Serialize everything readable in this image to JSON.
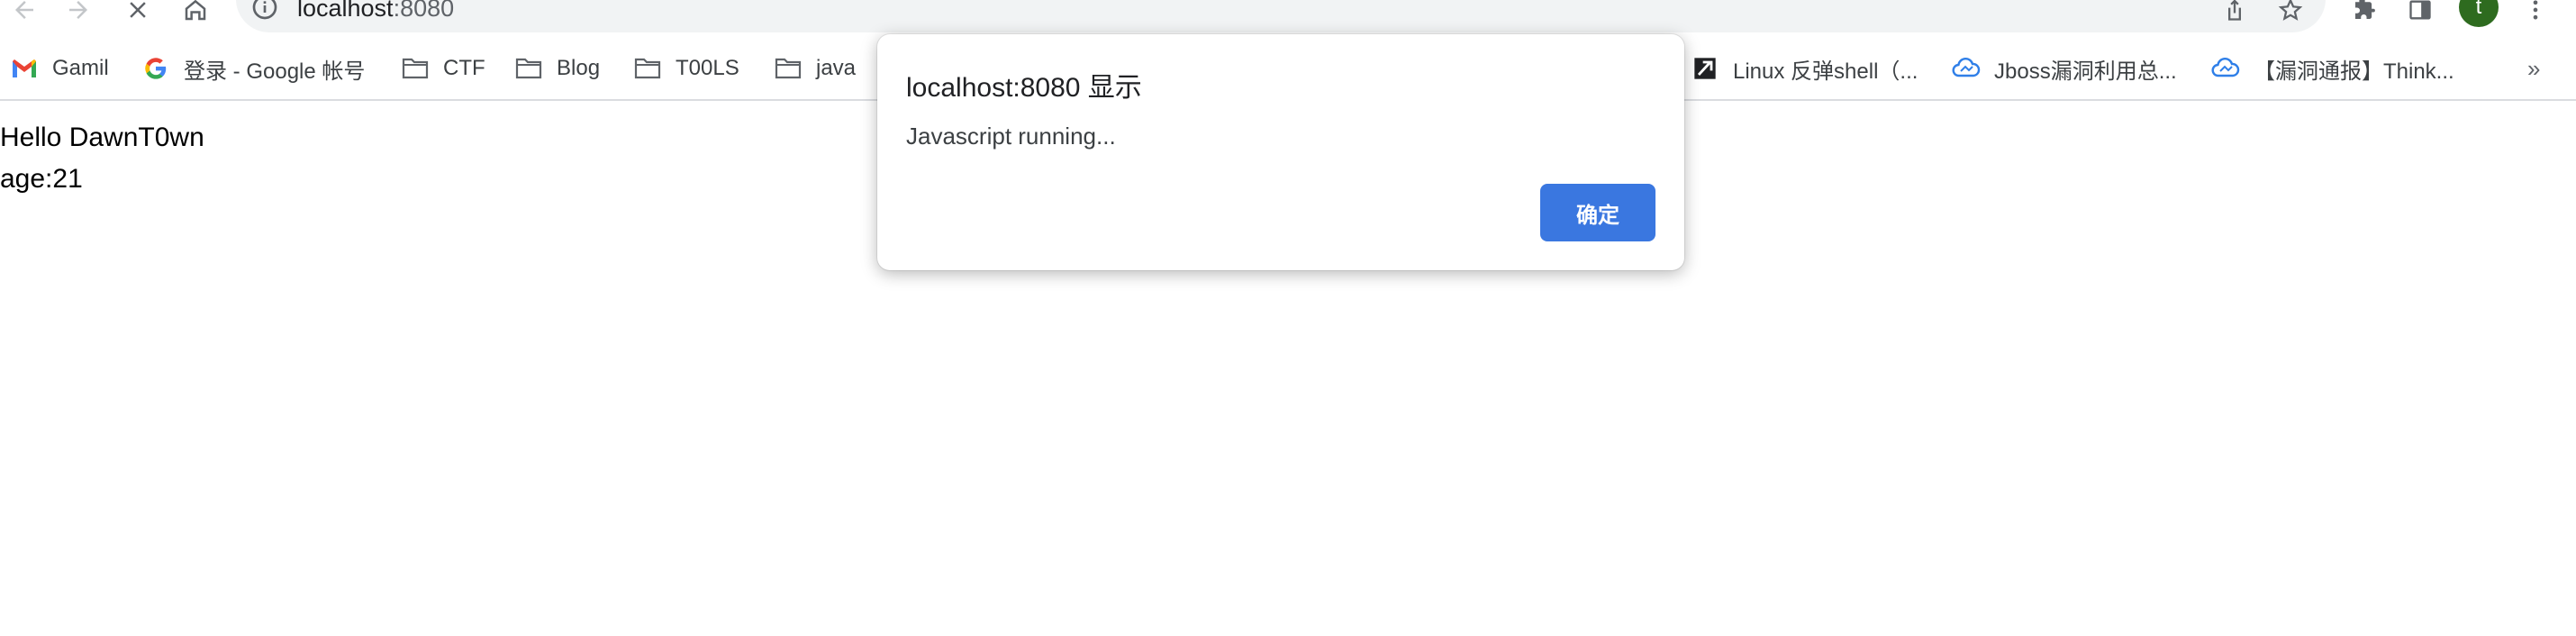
{
  "toolbar": {
    "url_host": "localhost",
    "url_port": ":8080",
    "avatar_initial": "t",
    "colors": {
      "avatar_bg": "#2e6b1f",
      "omnibox_bg": "#f1f3f4"
    }
  },
  "bookmarks": [
    {
      "label": "Gamil",
      "icon": "gmail-icon"
    },
    {
      "label": "登录 - Google 帐号",
      "icon": "google-icon"
    },
    {
      "label": "CTF",
      "icon": "folder-icon"
    },
    {
      "label": "Blog",
      "icon": "folder-icon"
    },
    {
      "label": "T00LS",
      "icon": "folder-icon"
    },
    {
      "label": "java",
      "icon": "folder-icon"
    },
    {
      "label": "Linux 反弹shell（...",
      "icon": "zhihu-style-icon"
    },
    {
      "label": "Jboss漏洞利用总...",
      "icon": "cloud-icon"
    },
    {
      "label": "【漏洞通报】Think...",
      "icon": "cloud-icon"
    }
  ],
  "bookmarks_more": "»",
  "page": {
    "line1": "Hello DawnT0wn",
    "line2": "age:21"
  },
  "dialog": {
    "title": "localhost:8080 显示",
    "message": "Javascript running...",
    "ok_label": "确定",
    "colors": {
      "ok_bg": "#3a77e0"
    }
  }
}
